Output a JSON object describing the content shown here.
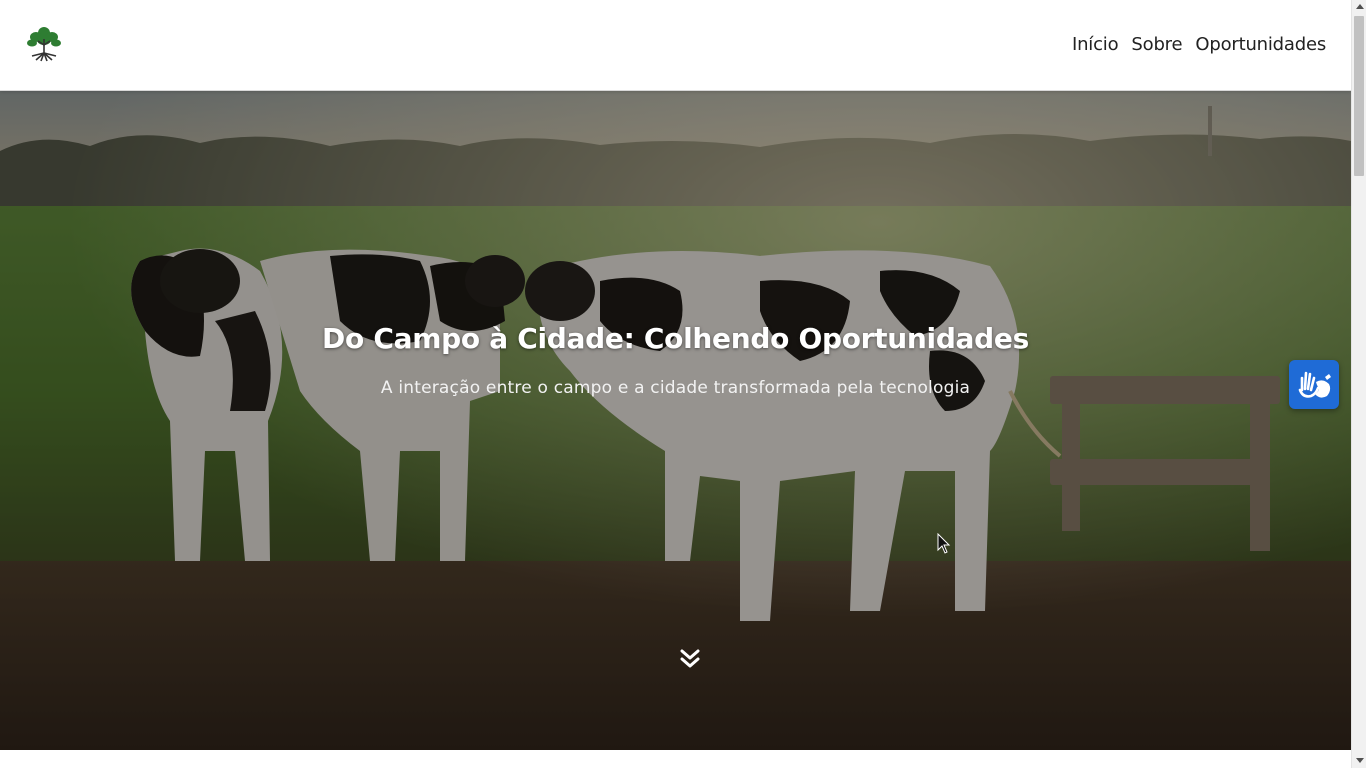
{
  "header": {
    "logo_icon": "tree-icon",
    "nav": [
      {
        "label": "Início"
      },
      {
        "label": "Sobre"
      },
      {
        "label": "Oportunidades"
      }
    ]
  },
  "hero": {
    "title": "Do Campo à Cidade: Colhendo Oportunidades",
    "subtitle": "A interação entre o campo e a cidade transformada pela tecnologia",
    "scroll_icon": "double-chevron-down-icon"
  },
  "accessibility": {
    "icon": "sign-language-hands-icon",
    "color": "#1f6bd6"
  }
}
